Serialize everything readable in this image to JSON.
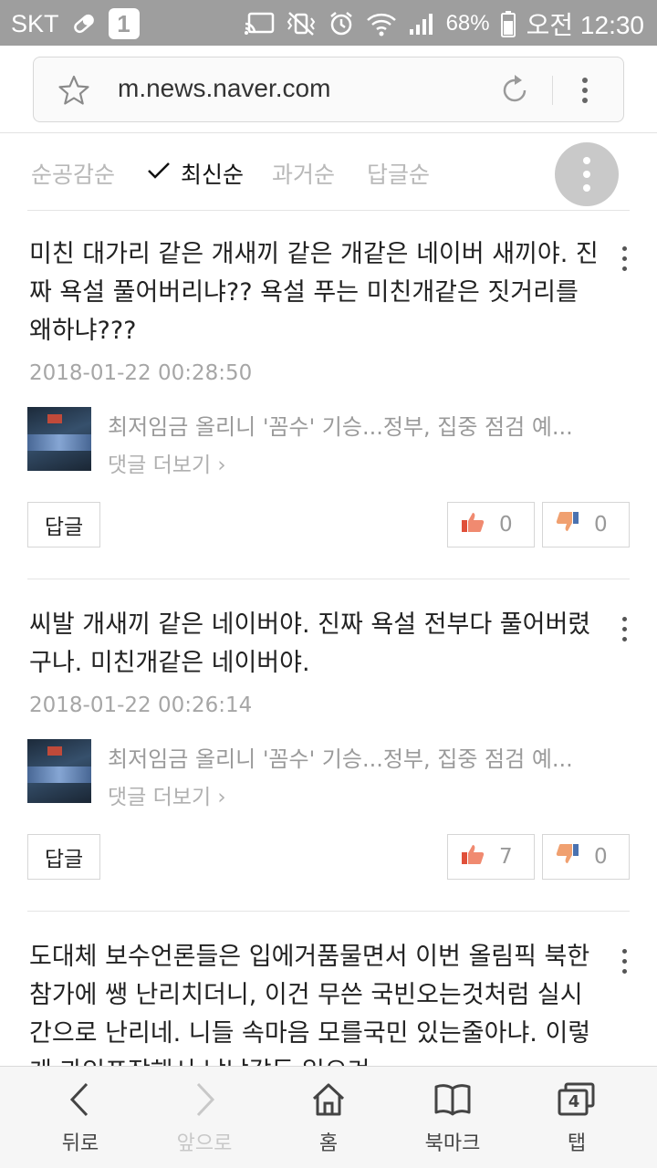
{
  "status_bar": {
    "carrier": "SKT",
    "sim_badge": "1",
    "battery": "68%",
    "time": "오전 12:30",
    "icons": [
      "pill-icon",
      "cast-icon",
      "vibrate-mute-icon",
      "alarm-icon",
      "wifi-icon",
      "signal-icon",
      "battery-icon"
    ]
  },
  "browser": {
    "url": "m.news.naver.com",
    "icons": [
      "star-icon",
      "reload-icon",
      "overflow-menu-icon"
    ]
  },
  "sort": {
    "tabs": [
      {
        "label": "순공감순",
        "active": false
      },
      {
        "label": "최신순",
        "active": true
      },
      {
        "label": "과거순",
        "active": false
      },
      {
        "label": "답글순",
        "active": false
      }
    ]
  },
  "comments": [
    {
      "text": "미친 대가리 같은 개새끼 같은 개같은 네이버 새끼야. 진짜 욕설 풀어버리냐?? 욕설 푸는 미친개같은 짓거리를 왜하냐???",
      "date": "2018-01-22 00:28:50",
      "article_title": "최저임금 올리니 '꼼수' 기승...정부, 집중 점검 예...",
      "more_link": "댓글 더보기",
      "reply_label": "답글",
      "likes": "0",
      "dislikes": "0"
    },
    {
      "text": "씨발 개새끼 같은 네이버야. 진짜 욕설 전부다 풀어버렸구나. 미친개같은 네이버야.",
      "date": "2018-01-22 00:26:14",
      "article_title": "최저임금 올리니 '꼼수' 기승...정부, 집중 점검 예...",
      "more_link": "댓글 더보기",
      "reply_label": "답글",
      "likes": "7",
      "dislikes": "0"
    },
    {
      "text": "도대체 보수언론들은 입에거품물면서 이번 올림픽 북한참가에 쌩 난리치더니, 이건 무쓴 국빈오는것처럼 실시간으로 난리네. 니들 속마음 모를국민 있는줄아냐. 이렇게 과잉포장해서 낚낚갈등 일으켜"
    }
  ],
  "bottom_nav": [
    {
      "label": "뒤로",
      "icon": "back-arrow-icon",
      "enabled": true
    },
    {
      "label": "앞으로",
      "icon": "forward-arrow-icon",
      "enabled": false
    },
    {
      "label": "홈",
      "icon": "home-icon",
      "enabled": true
    },
    {
      "label": "북마크",
      "icon": "bookmark-book-icon",
      "enabled": true
    },
    {
      "label": "탭",
      "icon": "tabs-icon",
      "enabled": true,
      "badge": "4"
    }
  ],
  "colors": {
    "status_bar": "#9e9e9e",
    "like_accent": "#e0503a",
    "dislike_accent": "#4a72b0",
    "muted_text": "#a6a6a6"
  }
}
